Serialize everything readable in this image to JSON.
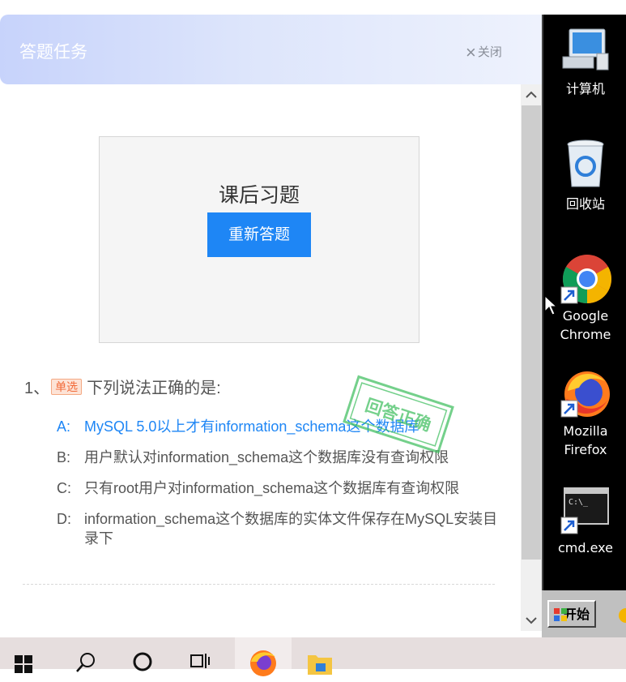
{
  "dialog": {
    "title": "答题任务",
    "close_label": "关闭",
    "close_icon": "×"
  },
  "exercise": {
    "title": "课后习题",
    "redo_button": "重新答题"
  },
  "question": {
    "number": "1、",
    "type_tag": "单选",
    "text": "下列说法正确的是:",
    "options": [
      {
        "letter": "A:",
        "text": "MySQL 5.0以上才有information_schema这个数据库",
        "selected": true
      },
      {
        "letter": "B:",
        "text": "用户默认对information_schema这个数据库没有查询权限",
        "selected": false
      },
      {
        "letter": "C:",
        "text": "只有root用户对information_schema这个数据库有查询权限",
        "selected": false
      },
      {
        "letter": "D:",
        "text": "information_schema这个数据库的实体文件保存在MySQL安装目录下",
        "selected": false
      }
    ],
    "stamp_text": "回答正确"
  },
  "scrollbar": {
    "up": "⌃",
    "down": "⌄"
  },
  "desktop": {
    "icons": [
      {
        "name": "computer-icon",
        "label": "计算机"
      },
      {
        "name": "recycle-bin-icon",
        "label": "回收站"
      },
      {
        "name": "chrome-icon",
        "label_line1": "Google",
        "label_line2": "Chrome"
      },
      {
        "name": "firefox-icon",
        "label_line1": "Mozilla",
        "label_line2": "Firefox"
      },
      {
        "name": "cmd-icon",
        "label": "cmd.exe"
      }
    ],
    "start_label": "开始"
  },
  "colors": {
    "accent": "#1e86f5",
    "tag": "#f26b3a",
    "stamp": "#3fbf5f"
  }
}
